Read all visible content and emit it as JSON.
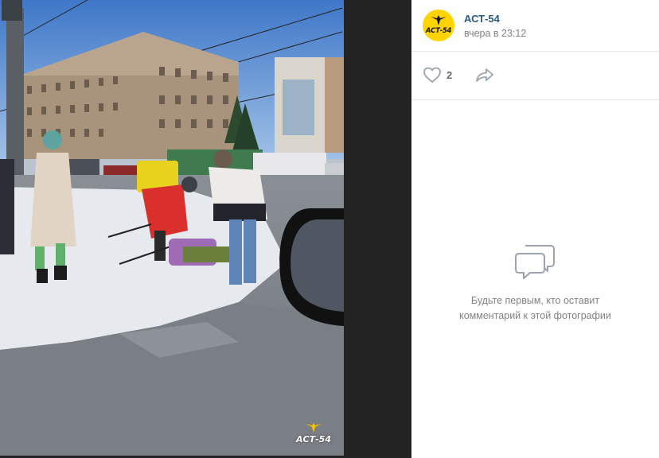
{
  "post": {
    "author_name": "АСТ-54",
    "avatar_text": "АСТ-54",
    "timestamp": "вчера в 23:12"
  },
  "actions": {
    "like_count": "2",
    "like_icon": "heart-icon",
    "share_icon": "share-arrow-icon"
  },
  "comments": {
    "empty_icon": "speech-bubbles-icon",
    "empty_text": "Будьте первым, кто оставит комментарий к этой фотографии"
  },
  "photo": {
    "watermark": "АСТ-54"
  },
  "colors": {
    "accent_link": "#2a5885",
    "brand_yellow": "#ffd400",
    "muted_text": "#828282",
    "icon_gray": "#99a2ad"
  }
}
